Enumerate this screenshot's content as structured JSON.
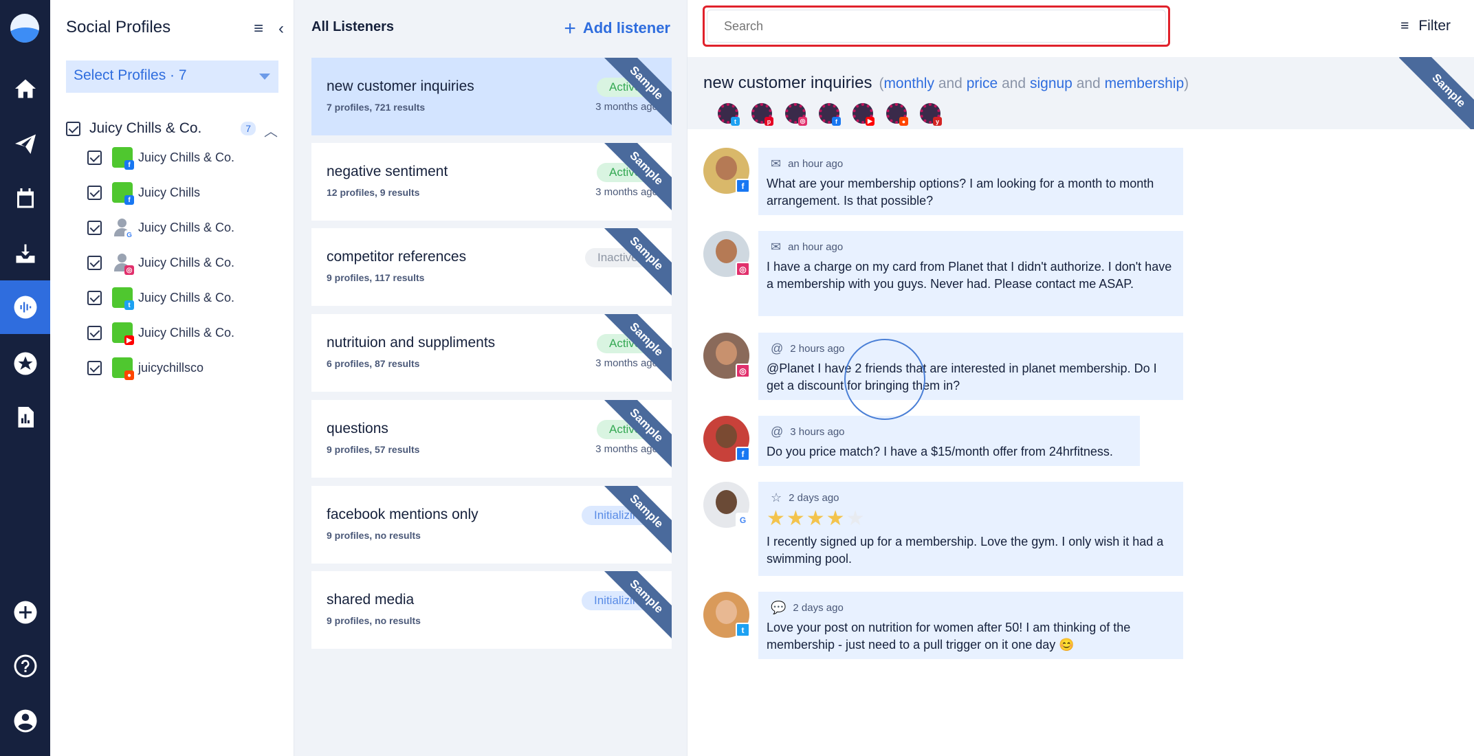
{
  "profiles_panel": {
    "title": "Social Profiles",
    "select_label": "Select Profiles · 7",
    "group": {
      "name": "Juicy Chills & Co.",
      "count": "7"
    },
    "items": [
      {
        "name": "Juicy Chills & Co.",
        "network": "facebook"
      },
      {
        "name": "Juicy Chills",
        "network": "facebook"
      },
      {
        "name": "Juicy Chills & Co.",
        "network": "google"
      },
      {
        "name": "Juicy Chills & Co.",
        "network": "instagram"
      },
      {
        "name": "Juicy Chills & Co.",
        "network": "twitter"
      },
      {
        "name": "Juicy Chills & Co.",
        "network": "youtube"
      },
      {
        "name": "juicychillsco",
        "network": "reddit"
      }
    ]
  },
  "listeners_panel": {
    "title": "All Listeners",
    "add_label": "Add listener",
    "ribbon": "Sample",
    "cards": [
      {
        "name": "new customer inquiries",
        "meta": "7 profiles, 721 results",
        "status": "Active",
        "time": "3 months ago"
      },
      {
        "name": "negative sentiment",
        "meta": "12 profiles, 9 results",
        "status": "Active",
        "time": "3 months ago"
      },
      {
        "name": "competitor references",
        "meta": "9 profiles, 117 results",
        "status": "Inactive",
        "time": ""
      },
      {
        "name": "nutrituion and suppliments",
        "meta": "6 profiles, 87 results",
        "status": "Active",
        "time": "3 months ago"
      },
      {
        "name": "questions",
        "meta": "9 profiles, 57 results",
        "status": "Active",
        "time": "3 months ago"
      },
      {
        "name": "facebook mentions only",
        "meta": "9 profiles, no results",
        "status": "Initializing",
        "time": ""
      },
      {
        "name": "shared media",
        "meta": "9 profiles, no results",
        "status": "Initializing",
        "time": ""
      }
    ]
  },
  "main": {
    "search": {
      "placeholder": "Search"
    },
    "filter_label": "Filter",
    "listener_title": "new customer inquiries",
    "terms": {
      "open": "(",
      "t1": "monthly",
      "and": "and",
      "t2": "price",
      "t3": "signup",
      "t4": "membership",
      "close": ")"
    },
    "ribbon": "Sample",
    "posts": [
      {
        "time": "an hour ago",
        "type_icon": "mail-icon",
        "network": "facebook",
        "text": "What are your membership options? I am looking for a month to month arrangement. Is that possible?"
      },
      {
        "time": "an hour ago",
        "type_icon": "mail-icon",
        "network": "instagram",
        "text": "I have a charge on my card from Planet that I didn't authorize. I don't have a membership with you guys. Never had. Please contact me ASAP."
      },
      {
        "time": "2 hours ago",
        "type_icon": "at-icon",
        "network": "instagram",
        "text": "@Planet I have 2 friends that are interested in planet membership. Do I get a discount for bringing them in?"
      },
      {
        "time": "3 hours ago",
        "type_icon": "at-icon",
        "network": "facebook",
        "text": "Do you price match? I have a $15/month offer from 24hrfitness."
      },
      {
        "time": "2 days ago",
        "type_icon": "star-icon",
        "network": "google",
        "rating": 4,
        "text": "I recently signed up for a membership. Love the gym. I only wish it had a swimming pool."
      },
      {
        "time": "2 days ago",
        "type_icon": "comment-icon",
        "network": "twitter",
        "text": "Love your post on nutrition for women after 50! I am thinking of the membership - just need to a pull trigger on it one day 😊"
      }
    ]
  },
  "colors": {
    "accent": "#2f6dde",
    "rail": "#16213e",
    "selected_card": "#d3e4ff",
    "ribbon": "#4a6a9c",
    "highlight_box": "#e0212b"
  }
}
